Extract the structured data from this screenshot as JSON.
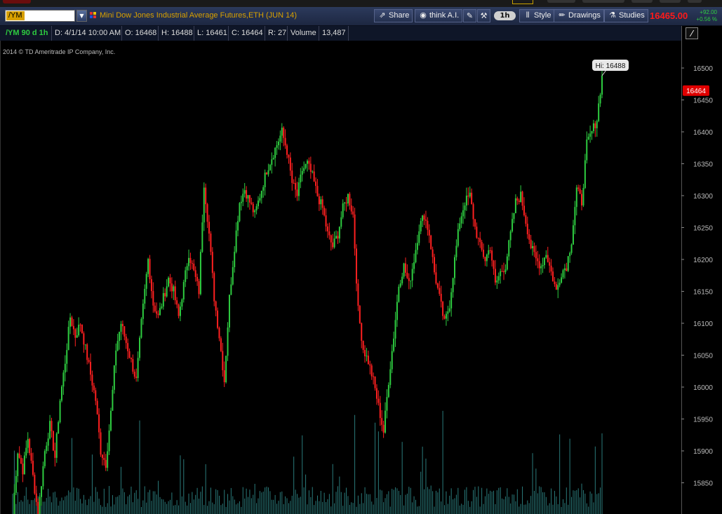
{
  "toolbar": {
    "symbol": "/YM",
    "description": "Mini Dow Jones Industrial Average Futures,ETH (JUN 14)",
    "share_label": "Share",
    "think_label": "think A.I.",
    "aggregation_label": "1h",
    "style_label": "Style",
    "drawings_label": "Drawings",
    "studies_label": "Studies",
    "last_price": "16465.00",
    "net_change": "+92.00",
    "pct_change": "+0.56 %"
  },
  "infobar": {
    "symbol_period": "/YM 90 d 1h",
    "date": "D: 4/1/14 10:00 AM",
    "open": "O: 16468",
    "high": "H: 16488",
    "low": "L: 16461",
    "close": "C: 16464",
    "range": "R: 27",
    "volume_label": "Volume",
    "volume_value": "13,487"
  },
  "chart": {
    "copyright": "2014 © TD Ameritrade IP Company, Inc.",
    "hi_bubble": "Hi: 16488",
    "last_bubble": "16464",
    "colors": {
      "up": "#2ecc40",
      "down": "#ff2020",
      "volume": "#2a7a7a",
      "last_bubble_bg": "#e00000"
    }
  },
  "chart_data": {
    "type": "candlestick",
    "title": "",
    "ylim": [
      15800,
      16550
    ],
    "y_ticks": [
      16500,
      16450,
      16400,
      16350,
      16300,
      16250,
      16200,
      16150,
      16100,
      16050,
      16000,
      15950,
      15900,
      15850
    ],
    "path": [
      [
        0,
        15800
      ],
      [
        3,
        15900
      ],
      [
        6,
        15870
      ],
      [
        9,
        15920
      ],
      [
        12,
        15860
      ],
      [
        15,
        15800
      ],
      [
        19,
        15900
      ],
      [
        22,
        15940
      ],
      [
        25,
        15890
      ],
      [
        28,
        15980
      ],
      [
        31,
        16040
      ],
      [
        34,
        16110
      ],
      [
        37,
        16080
      ],
      [
        40,
        16100
      ],
      [
        43,
        16060
      ],
      [
        46,
        16020
      ],
      [
        49,
        15980
      ],
      [
        52,
        15900
      ],
      [
        55,
        15880
      ],
      [
        58,
        15960
      ],
      [
        61,
        16060
      ],
      [
        64,
        16100
      ],
      [
        67,
        16070
      ],
      [
        70,
        16040
      ],
      [
        73,
        16010
      ],
      [
        76,
        16100
      ],
      [
        80,
        16200
      ],
      [
        83,
        16130
      ],
      [
        86,
        16110
      ],
      [
        89,
        16140
      ],
      [
        92,
        16170
      ],
      [
        95,
        16150
      ],
      [
        98,
        16110
      ],
      [
        101,
        16160
      ],
      [
        104,
        16210
      ],
      [
        107,
        16180
      ],
      [
        110,
        16150
      ],
      [
        113,
        16320
      ],
      [
        116,
        16240
      ],
      [
        119,
        16140
      ],
      [
        122,
        16080
      ],
      [
        125,
        16010
      ],
      [
        128,
        16140
      ],
      [
        131,
        16220
      ],
      [
        134,
        16290
      ],
      [
        137,
        16310
      ],
      [
        140,
        16290
      ],
      [
        143,
        16270
      ],
      [
        146,
        16300
      ],
      [
        150,
        16340
      ],
      [
        153,
        16360
      ],
      [
        156,
        16380
      ],
      [
        159,
        16400
      ],
      [
        162,
        16370
      ],
      [
        165,
        16320
      ],
      [
        168,
        16300
      ],
      [
        171,
        16340
      ],
      [
        174,
        16350
      ],
      [
        177,
        16330
      ],
      [
        180,
        16300
      ],
      [
        183,
        16280
      ],
      [
        186,
        16240
      ],
      [
        189,
        16220
      ],
      [
        192,
        16240
      ],
      [
        195,
        16280
      ],
      [
        198,
        16300
      ],
      [
        201,
        16270
      ],
      [
        204,
        16120
      ],
      [
        207,
        16060
      ],
      [
        210,
        16040
      ],
      [
        213,
        16010
      ],
      [
        216,
        15970
      ],
      [
        219,
        15930
      ],
      [
        222,
        16010
      ],
      [
        225,
        16080
      ],
      [
        228,
        16160
      ],
      [
        231,
        16190
      ],
      [
        234,
        16160
      ],
      [
        237,
        16200
      ],
      [
        240,
        16250
      ],
      [
        243,
        16270
      ],
      [
        246,
        16240
      ],
      [
        249,
        16180
      ],
      [
        252,
        16140
      ],
      [
        255,
        16100
      ],
      [
        258,
        16130
      ],
      [
        261,
        16200
      ],
      [
        264,
        16260
      ],
      [
        267,
        16290
      ],
      [
        270,
        16300
      ],
      [
        273,
        16250
      ],
      [
        276,
        16220
      ],
      [
        279,
        16200
      ],
      [
        282,
        16220
      ],
      [
        285,
        16160
      ],
      [
        288,
        16180
      ],
      [
        291,
        16190
      ],
      [
        294,
        16240
      ],
      [
        297,
        16290
      ],
      [
        300,
        16300
      ],
      [
        303,
        16260
      ],
      [
        306,
        16220
      ],
      [
        309,
        16200
      ],
      [
        312,
        16190
      ],
      [
        315,
        16210
      ],
      [
        318,
        16180
      ],
      [
        321,
        16150
      ],
      [
        324,
        16180
      ],
      [
        327,
        16190
      ],
      [
        330,
        16230
      ],
      [
        333,
        16310
      ],
      [
        336,
        16290
      ],
      [
        339,
        16380
      ],
      [
        342,
        16400
      ],
      [
        345,
        16420
      ],
      [
        348,
        16488
      ]
    ]
  }
}
